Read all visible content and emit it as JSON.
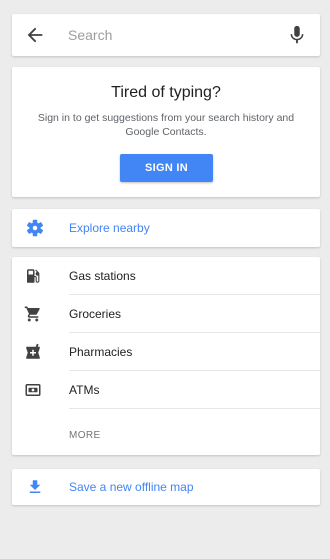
{
  "search": {
    "placeholder": "Search"
  },
  "signin": {
    "title": "Tired of typing?",
    "description": "Sign in to get suggestions from your search history and Google Contacts.",
    "button_label": "SIGN IN"
  },
  "explore": {
    "label": "Explore nearby",
    "icon": "gear-icon"
  },
  "categories": {
    "items": [
      {
        "label": "Gas stations",
        "icon": "gas-station-icon"
      },
      {
        "label": "Groceries",
        "icon": "shopping-cart-icon"
      },
      {
        "label": "Pharmacies",
        "icon": "pharmacy-icon"
      },
      {
        "label": "ATMs",
        "icon": "atm-icon"
      }
    ],
    "more_label": "MORE"
  },
  "offline": {
    "label": "Save a new offline map",
    "icon": "download-icon"
  },
  "colors": {
    "accent": "#4285f4",
    "background": "#ececec",
    "icon_dark": "#424242"
  }
}
